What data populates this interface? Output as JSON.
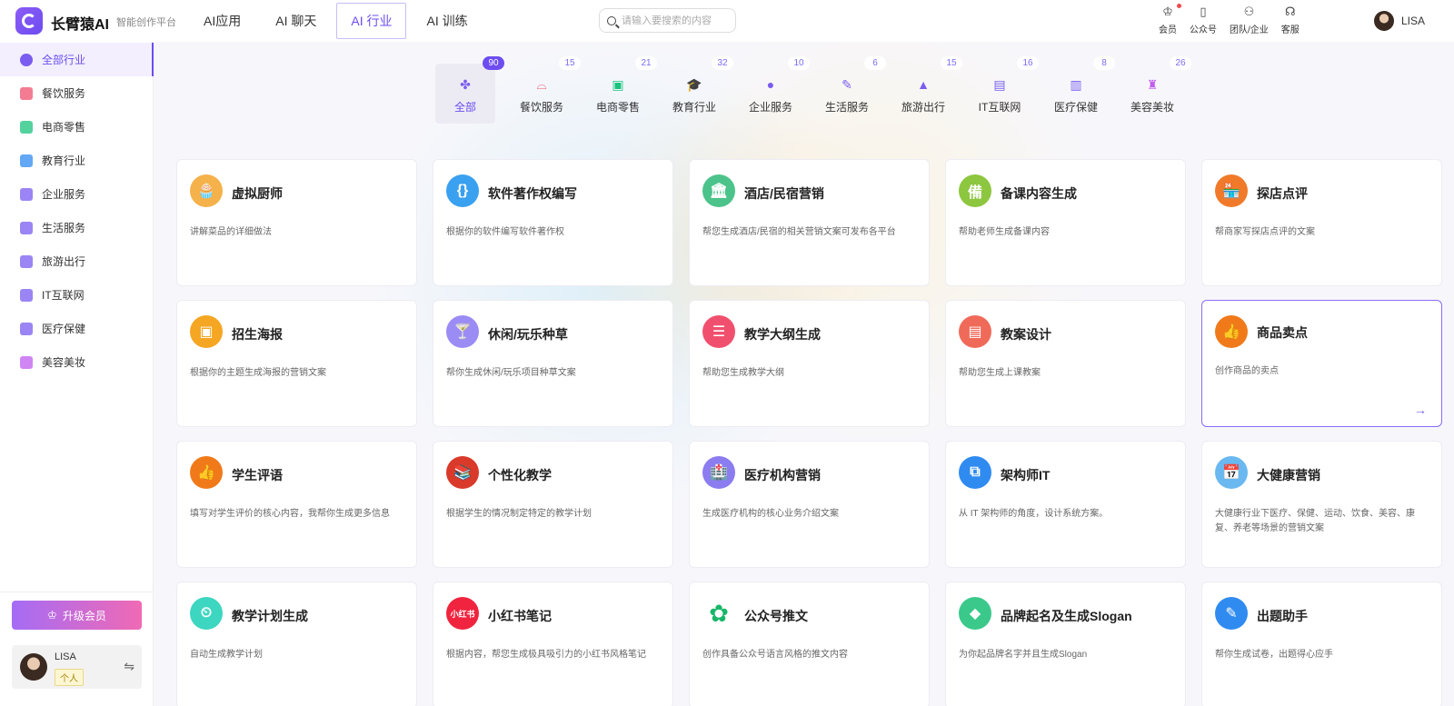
{
  "header": {
    "app_name": "长臂猿AI",
    "app_sub": "智能创作平台",
    "nav": [
      {
        "label": "AI应用",
        "active": false
      },
      {
        "label": "AI 聊天",
        "active": false
      },
      {
        "label": "AI 行业",
        "active": true
      },
      {
        "label": "AI 训练",
        "active": false
      }
    ],
    "search_placeholder": "请输入要搜索的内容",
    "tools": [
      {
        "label": "会员",
        "icon": "crown-icon",
        "dot": true
      },
      {
        "label": "公众号",
        "icon": "phone-icon",
        "dot": false
      },
      {
        "label": "团队/企业",
        "icon": "team-icon",
        "dot": false
      },
      {
        "label": "客服",
        "icon": "headset-icon",
        "dot": false
      }
    ],
    "user": "LISA"
  },
  "sidebar": {
    "items": [
      {
        "label": "全部行业",
        "color": "#7a5cf0",
        "active": true
      },
      {
        "label": "餐饮服务",
        "color": "#f0506e",
        "active": false
      },
      {
        "label": "电商零售",
        "color": "#19c37d",
        "active": false
      },
      {
        "label": "教育行业",
        "color": "#2f8bf0",
        "active": false
      },
      {
        "label": "企业服务",
        "color": "#7a5cf0",
        "active": false
      },
      {
        "label": "生活服务",
        "color": "#7a5cf0",
        "active": false
      },
      {
        "label": "旅游出行",
        "color": "#7a5cf0",
        "active": false
      },
      {
        "label": "IT互联网",
        "color": "#7a5cf0",
        "active": false
      },
      {
        "label": "医疗保健",
        "color": "#7a5cf0",
        "active": false
      },
      {
        "label": "美容美妆",
        "color": "#c05cf0",
        "active": false
      }
    ],
    "upgrade_label": "升级会员",
    "user_name": "LISA",
    "user_badge": "个人"
  },
  "categories": [
    {
      "label": "全部",
      "count": "90",
      "icon": "grid-icon",
      "color": "#7a5cf0",
      "active": true
    },
    {
      "label": "餐饮服务",
      "count": "15",
      "icon": "dish-icon",
      "color": "#f0506e",
      "active": false
    },
    {
      "label": "电商零售",
      "count": "21",
      "icon": "shop-bag-icon",
      "color": "#19c37d",
      "active": false
    },
    {
      "label": "教育行业",
      "count": "32",
      "icon": "graduation-icon",
      "color": "#2f8bf0",
      "active": false
    },
    {
      "label": "企业服务",
      "count": "10",
      "icon": "chat-icon",
      "color": "#7a5cf0",
      "active": false
    },
    {
      "label": "生活服务",
      "count": "6",
      "icon": "pen-icon",
      "color": "#7a5cf0",
      "active": false
    },
    {
      "label": "旅游出行",
      "count": "15",
      "icon": "mountain-icon",
      "color": "#7a5cf0",
      "active": false
    },
    {
      "label": "IT互联网",
      "count": "16",
      "icon": "doc-icon",
      "color": "#7a5cf0",
      "active": false
    },
    {
      "label": "医疗保健",
      "count": "8",
      "icon": "hospital-icon",
      "color": "#7a5cf0",
      "active": false
    },
    {
      "label": "美容美妆",
      "count": "26",
      "icon": "cosmetics-icon",
      "color": "#c05cf0",
      "active": false
    }
  ],
  "cards": [
    {
      "title": "虚拟厨师",
      "desc": "讲解菜品的详细做法",
      "icon": "chef-icon",
      "color": "#f5b14a",
      "glyph": "🧁"
    },
    {
      "title": "软件著作权编写",
      "desc": "根据你的软件编写软件著作权",
      "icon": "code-icon",
      "color": "#3aa0f0",
      "glyph": "{}"
    },
    {
      "title": "酒店/民宿营销",
      "desc": "帮您生成酒店/民宿的相关营销文案可发布各平台",
      "icon": "bank-icon",
      "color": "#4cc38a",
      "glyph": "🏛"
    },
    {
      "title": "备课内容生成",
      "desc": "帮助老师生成备课内容",
      "icon": "book-icon",
      "color": "#8dc63f",
      "glyph": "備"
    },
    {
      "title": "探店点评",
      "desc": "帮商家写探店点评的文案",
      "icon": "store-icon",
      "color": "#f07a2a",
      "glyph": "🏪"
    },
    {
      "title": "招生海报",
      "desc": "根据你的主题生成海报的营销文案",
      "icon": "poster-icon",
      "color": "#f5a623",
      "glyph": "▣"
    },
    {
      "title": "休闲/玩乐种草",
      "desc": "帮你生成休闲/玩乐项目种草文案",
      "icon": "cocktail-icon",
      "color": "#9b8cf5",
      "glyph": "🍸"
    },
    {
      "title": "教学大纲生成",
      "desc": "帮助您生成教学大纲",
      "icon": "list-icon",
      "color": "#f0506e",
      "glyph": "☰"
    },
    {
      "title": "教案设计",
      "desc": "帮助您生成上课教案",
      "icon": "bag-icon",
      "color": "#f06a5a",
      "glyph": "▤"
    },
    {
      "title": "商品卖点",
      "desc": "创作商品的卖点",
      "icon": "thumb-up-icon",
      "color": "#f07a1a",
      "glyph": "👍",
      "hover": true
    },
    {
      "title": "学生评语",
      "desc": "填写对学生评价的核心内容，我帮你生成更多信息",
      "icon": "thumb-up-icon",
      "color": "#f07a1a",
      "glyph": "👍"
    },
    {
      "title": "个性化教学",
      "desc": "根据学生的情况制定特定的教学计划",
      "icon": "books-icon",
      "color": "#d93a2a",
      "glyph": "📚"
    },
    {
      "title": "医疗机构营销",
      "desc": "生成医疗机构的核心业务介绍文案",
      "icon": "hospital-icon",
      "color": "#8b7cf0",
      "glyph": "🏥"
    },
    {
      "title": "架构师IT",
      "desc": "从 IT 架构师的角度，设计系统方案。",
      "icon": "network-icon",
      "color": "#2f8bf0",
      "glyph": "⧉"
    },
    {
      "title": "大健康营销",
      "desc": "大健康行业下医疗、保健、运动、饮食、美容、康复、养老等场景的营销文案",
      "icon": "calendar-plus-icon",
      "color": "#6ab8f0",
      "glyph": "📅"
    },
    {
      "title": "教学计划生成",
      "desc": "自动生成教学计划",
      "icon": "plan-icon",
      "color": "#3dd6c0",
      "glyph": "⏲"
    },
    {
      "title": "小红书笔记",
      "desc": "根据内容，帮您生成极具吸引力的小红书风格笔记",
      "icon": "xiaohongshu-icon",
      "color": "#f0243e",
      "glyph": "小红书"
    },
    {
      "title": "公众号推文",
      "desc": "创作具备公众号语言风格的推文内容",
      "icon": "wechat-icon",
      "color": "#ffffff",
      "glyph": "✿"
    },
    {
      "title": "品牌起名及生成Slogan",
      "desc": "为你起品牌名字并且生成Slogan",
      "icon": "diamond-icon",
      "color": "#3ac98a",
      "glyph": "◆"
    },
    {
      "title": "出题助手",
      "desc": "帮你生成试卷，出题得心应手",
      "icon": "exam-icon",
      "color": "#2f8bf0",
      "glyph": "✎"
    }
  ]
}
